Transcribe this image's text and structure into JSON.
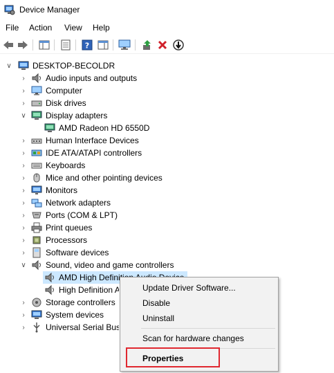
{
  "window": {
    "title": "Device Manager"
  },
  "menu": [
    "File",
    "Action",
    "View",
    "Help"
  ],
  "tree": {
    "root": "DESKTOP-BECOLDR",
    "categories": [
      "Audio inputs and outputs",
      "Computer",
      "Disk drives",
      "Display adapters",
      "AMD Radeon HD 6550D",
      "Human Interface Devices",
      "IDE ATA/ATAPI controllers",
      "Keyboards",
      "Mice and other pointing devices",
      "Monitors",
      "Network adapters",
      "Ports (COM & LPT)",
      "Print queues",
      "Processors",
      "Software devices",
      "Sound, video and game controllers",
      "AMD High Definition Audio Device",
      "High Definition Audio Device",
      "Storage controllers",
      "System devices",
      "Universal Serial Bus controllers"
    ],
    "truncated": [
      "AMD High Definition Audio Device",
      "High Definition A"
    ],
    "usb_truncated": "Universal Serial Bus"
  },
  "context_menu": {
    "items": [
      "Update Driver Software...",
      "Disable",
      "Uninstall",
      "Scan for hardware changes",
      "Properties"
    ]
  },
  "colors": {
    "selection": "#cce8ff",
    "highlight_border": "#e0272f",
    "menu_bg": "#f2f2f2"
  }
}
